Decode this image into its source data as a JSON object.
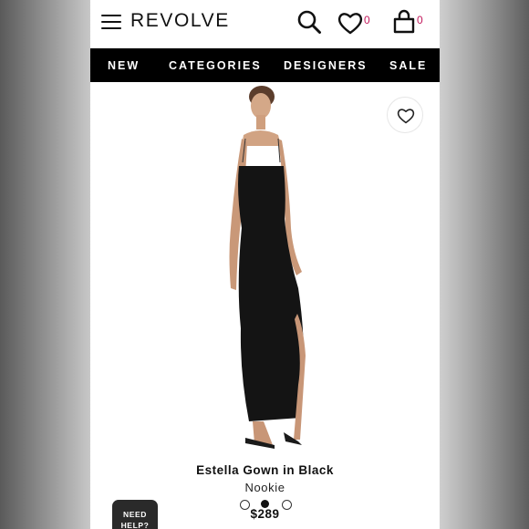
{
  "header": {
    "logo": "REVOLVE",
    "wishlist_count": "0",
    "bag_count": "0",
    "icons": [
      "menu-icon",
      "search-icon",
      "heart-icon",
      "bag-icon"
    ]
  },
  "nav": {
    "items": [
      {
        "label": "NEW"
      },
      {
        "label": "CATEGORIES"
      },
      {
        "label": "DESIGNERS"
      },
      {
        "label": "SALE"
      }
    ]
  },
  "product": {
    "title": "Estella Gown in Black",
    "brand": "Nookie",
    "price": "$289",
    "carousel_total": 3,
    "carousel_active": 1
  },
  "help": {
    "line1": "NEED",
    "line2": "HELP?"
  },
  "colors": {
    "accent": "#c2185b",
    "nav_bg": "#000000"
  }
}
